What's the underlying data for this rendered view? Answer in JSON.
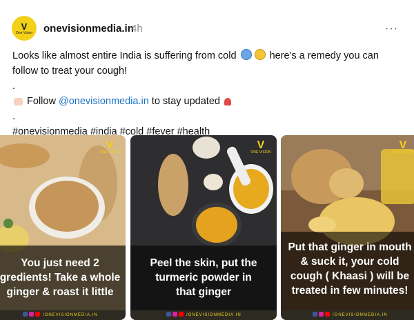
{
  "post": {
    "username": "onevisionmedia.in",
    "timestamp": "4h",
    "more": "···",
    "avatar_text": "One Vision"
  },
  "caption": {
    "line1_a": "Looks like almost entire India is suffering from cold",
    "line1_b": "here's a remedy you can",
    "line2": "follow to treat your cough!",
    "dot1": ".",
    "follow_a": "Follow ",
    "follow_link": "@onevisionmedia.in",
    "follow_b": " to stay updated",
    "dot2": ".",
    "hashtags": "#onevisionmedia #india #cold #fever #health"
  },
  "cards": [
    {
      "text": "You just need 2 ingredients! Take a whole ginger & roast it little",
      "lines": [
        "You just need 2",
        "gredients! Take a whole",
        "ginger & roast it little"
      ]
    },
    {
      "text": "Peel the skin, put the turmeric powder in that ginger",
      "lines": [
        "Peel the skin, put the",
        "turmeric powder in",
        "that ginger"
      ]
    },
    {
      "text": "Put that ginger in mouth & suck it, your cold cough ( Khaasi ) will be treated in few minutes!",
      "lines": [
        "Put that ginger in mouth",
        "& suck it, your cold",
        "cough ( Khaasi ) will be",
        "treated in few minutes!"
      ]
    }
  ],
  "card_brand": {
    "mark": "V",
    "small": "ONE VISION"
  },
  "card_footer": "/ONEVISIONMEDIA.IN",
  "colors": {
    "accent_yellow": "#f3d11b",
    "link_blue": "#1a73c7"
  }
}
